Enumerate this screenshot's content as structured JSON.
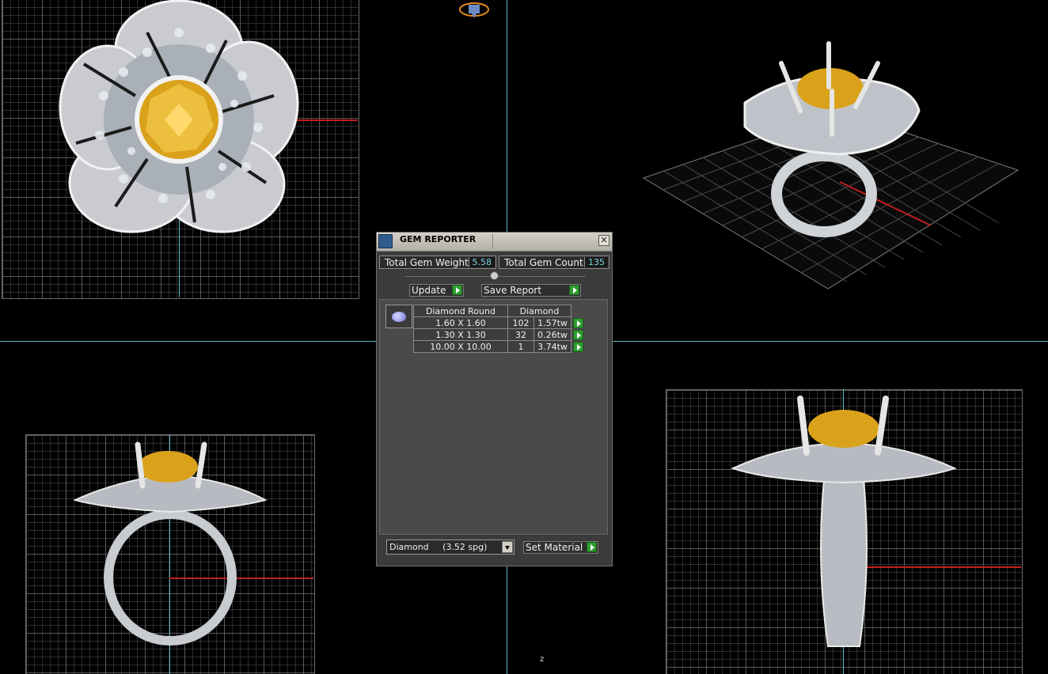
{
  "window": {
    "title": "GEM REPORTER"
  },
  "stats": {
    "total_weight_label": "Total Gem Weight",
    "total_weight_value": "5.58",
    "total_count_label": "Total Gem Count",
    "total_count_value": "135"
  },
  "buttons": {
    "update": "Update",
    "save_report": "Save Report",
    "set_material": "Set Material"
  },
  "table": {
    "headers": [
      "Diamond Round",
      "Diamond"
    ],
    "rows": [
      {
        "size": "1.60 X 1.60",
        "count": "102",
        "weight": "1.57tw"
      },
      {
        "size": "1.30 X 1.30",
        "count": "32",
        "weight": "0.26tw"
      },
      {
        "size": "10.00 X 10.00",
        "count": "1",
        "weight": "3.74tw"
      }
    ]
  },
  "material_select": {
    "value": "Diamond     (3.52 spg)"
  },
  "axis_label": "z",
  "colors": {
    "accent_green": "#2e9e2e",
    "axis_cyan": "#5fb7c9",
    "axis_red": "#c21f1f",
    "value_text": "#7fd3e8"
  },
  "icons": [
    "gem-reporter-app-icon",
    "close-icon",
    "gem-preview-icon",
    "go-arrow-icon",
    "dropdown-arrow-icon"
  ]
}
